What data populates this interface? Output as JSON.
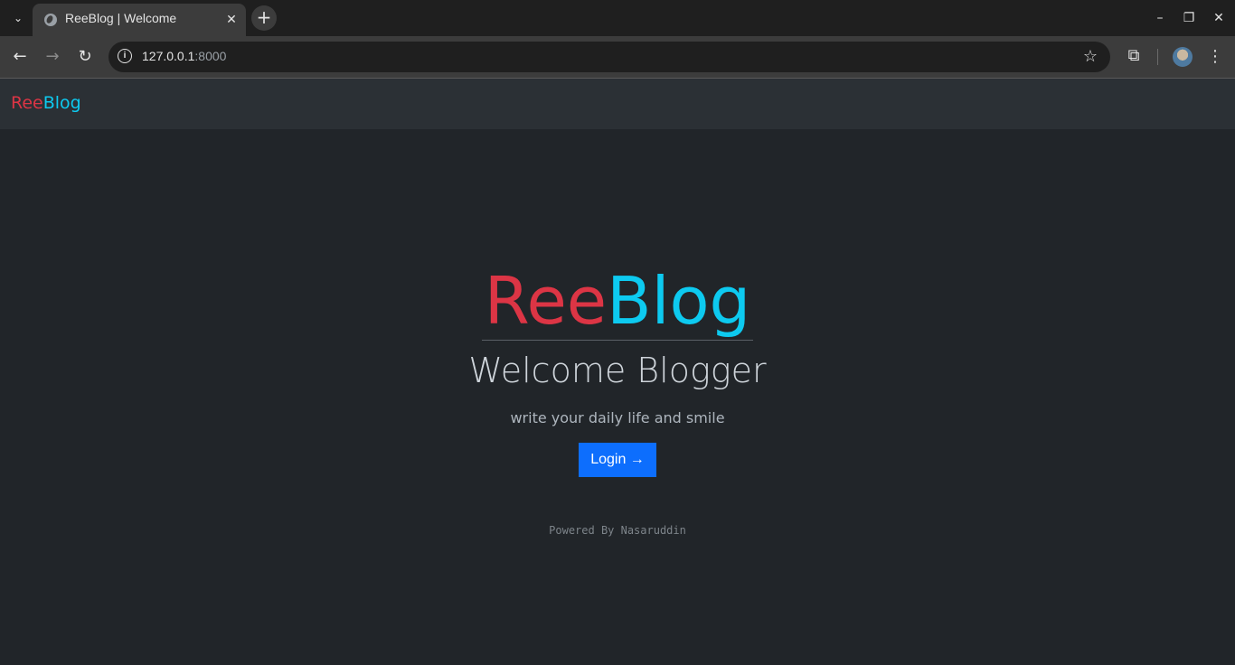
{
  "browser": {
    "tab_title": "ReeBlog | Welcome",
    "tab_close": "✕",
    "new_tab": "+",
    "url_host": "127.0.0.1",
    "url_port": ":8000",
    "window_minimize": "–",
    "window_restore": "❐",
    "window_close": "✕"
  },
  "navbar": {
    "brand_part1": "Ree",
    "brand_part2": "Blog"
  },
  "hero": {
    "title_part1": "Ree",
    "title_part2": "Blog",
    "welcome": "Welcome Blogger",
    "tagline": "write your daily life and smile",
    "login_label": "Login →"
  },
  "footer": {
    "powered_by": "Powered By Nasaruddin"
  },
  "colors": {
    "brand_red": "#dc3545",
    "brand_cyan": "#0dcaf0",
    "primary_button": "#0d6efd",
    "page_background": "#212529",
    "navbar_background": "#2b3035"
  }
}
